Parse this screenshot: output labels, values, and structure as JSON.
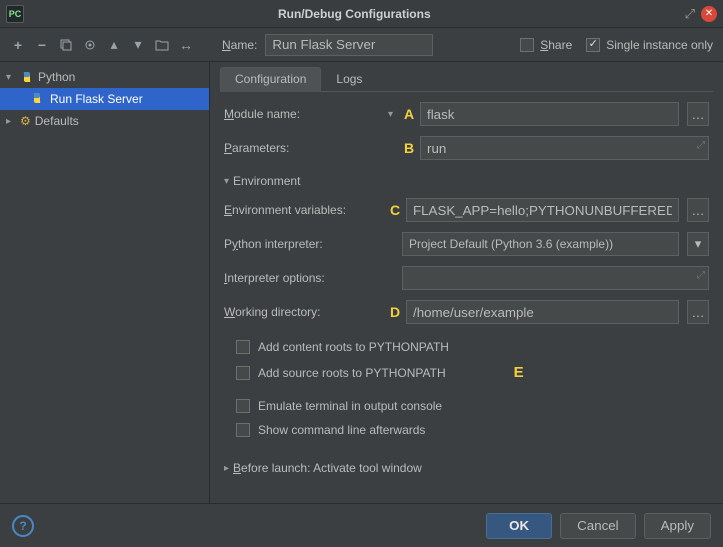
{
  "titlebar": {
    "app_badge": "PC",
    "title": "Run/Debug Configurations"
  },
  "toolbar": {
    "name_label": "Name:",
    "name_value": "Run Flask Server",
    "share_label": "Share",
    "share_checked": false,
    "single_instance_label": "Single instance only",
    "single_instance_checked": true
  },
  "sidebar": {
    "python_label": "Python",
    "run_flask_label": "Run Flask Server",
    "defaults_label": "Defaults"
  },
  "tabs": {
    "configuration": "Configuration",
    "logs": "Logs"
  },
  "markers": {
    "a": "A",
    "b": "B",
    "c": "C",
    "d": "D",
    "e": "E"
  },
  "form": {
    "module_name_label": "Module name:",
    "module_name_value": "flask",
    "parameters_label": "Parameters:",
    "parameters_value": "run",
    "environment_header": "Environment",
    "env_vars_label": "Environment variables:",
    "env_vars_value": "FLASK_APP=hello;PYTHONUNBUFFERED=",
    "python_interp_label": "Python interpreter:",
    "python_interp_value": "Project Default (Python 3.6 (example))",
    "interp_options_label": "Interpreter options:",
    "interp_options_value": "",
    "working_dir_label": "Working directory:",
    "working_dir_value": "/home/user/example",
    "add_content_roots": "Add content roots to PYTHONPATH",
    "add_source_roots": "Add source roots to PYTHONPATH",
    "emulate_terminal": "Emulate terminal in output console",
    "show_cmd_after": "Show command line afterwards",
    "before_launch": "Before launch: Activate tool window"
  },
  "footer": {
    "ok": "OK",
    "cancel": "Cancel",
    "apply": "Apply"
  }
}
